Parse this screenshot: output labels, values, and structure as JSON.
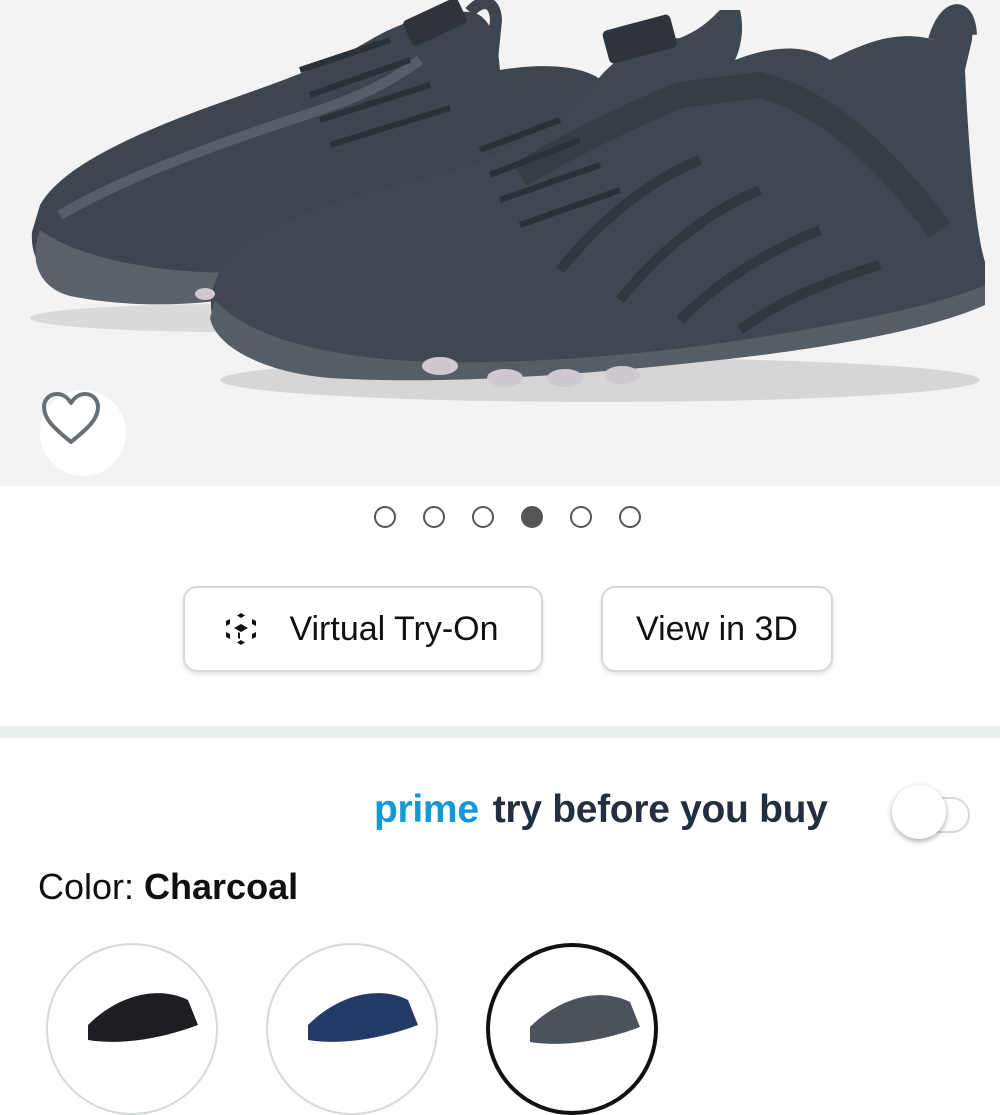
{
  "carousel": {
    "total": 6,
    "active_index": 3
  },
  "buttons": {
    "virtual_tryon": "Virtual Try-On",
    "view_3d": "View in 3D"
  },
  "prime": {
    "brand": "prime",
    "text": "try before you buy",
    "toggle_on": false,
    "brand_color": "#1399d6"
  },
  "color": {
    "label": "Color:",
    "value": "Charcoal"
  },
  "swatches": [
    {
      "name": "Black",
      "color": "#1e1e22"
    },
    {
      "name": "Navy",
      "color": "#243a66"
    },
    {
      "name": "Charcoal",
      "color": "#4c535a",
      "selected": true
    }
  ],
  "icons": [
    "heart-icon",
    "cube-ar-icon"
  ]
}
